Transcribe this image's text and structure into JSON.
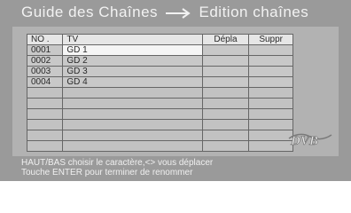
{
  "header": {
    "title": "Guide des Chaînes",
    "arrow_icon": "right-arrow-icon",
    "subtitle": "Edition chaînes"
  },
  "table": {
    "columns": [
      "NO .",
      "TV",
      "Dépla",
      "Suppr"
    ],
    "rows": [
      {
        "no": "0001",
        "tv": "GD 1",
        "selected": true
      },
      {
        "no": "0002",
        "tv": "GD 2",
        "selected": false
      },
      {
        "no": "0003",
        "tv": "GD 3",
        "selected": false
      },
      {
        "no": "0004",
        "tv": "GD 4",
        "selected": false
      }
    ],
    "empty_rows": 6
  },
  "logo": {
    "text": "DVB"
  },
  "footer": {
    "line1": "HAUT/BAS choisir le caractère,<> vous déplacer",
    "line2": "Touche ENTER pour terminer de renommer"
  },
  "colors": {
    "background": "#9a9a9a",
    "panel": "#b2b2b2",
    "selected_cell": "#f5f5f5",
    "title_text": "#f2f2f2"
  }
}
